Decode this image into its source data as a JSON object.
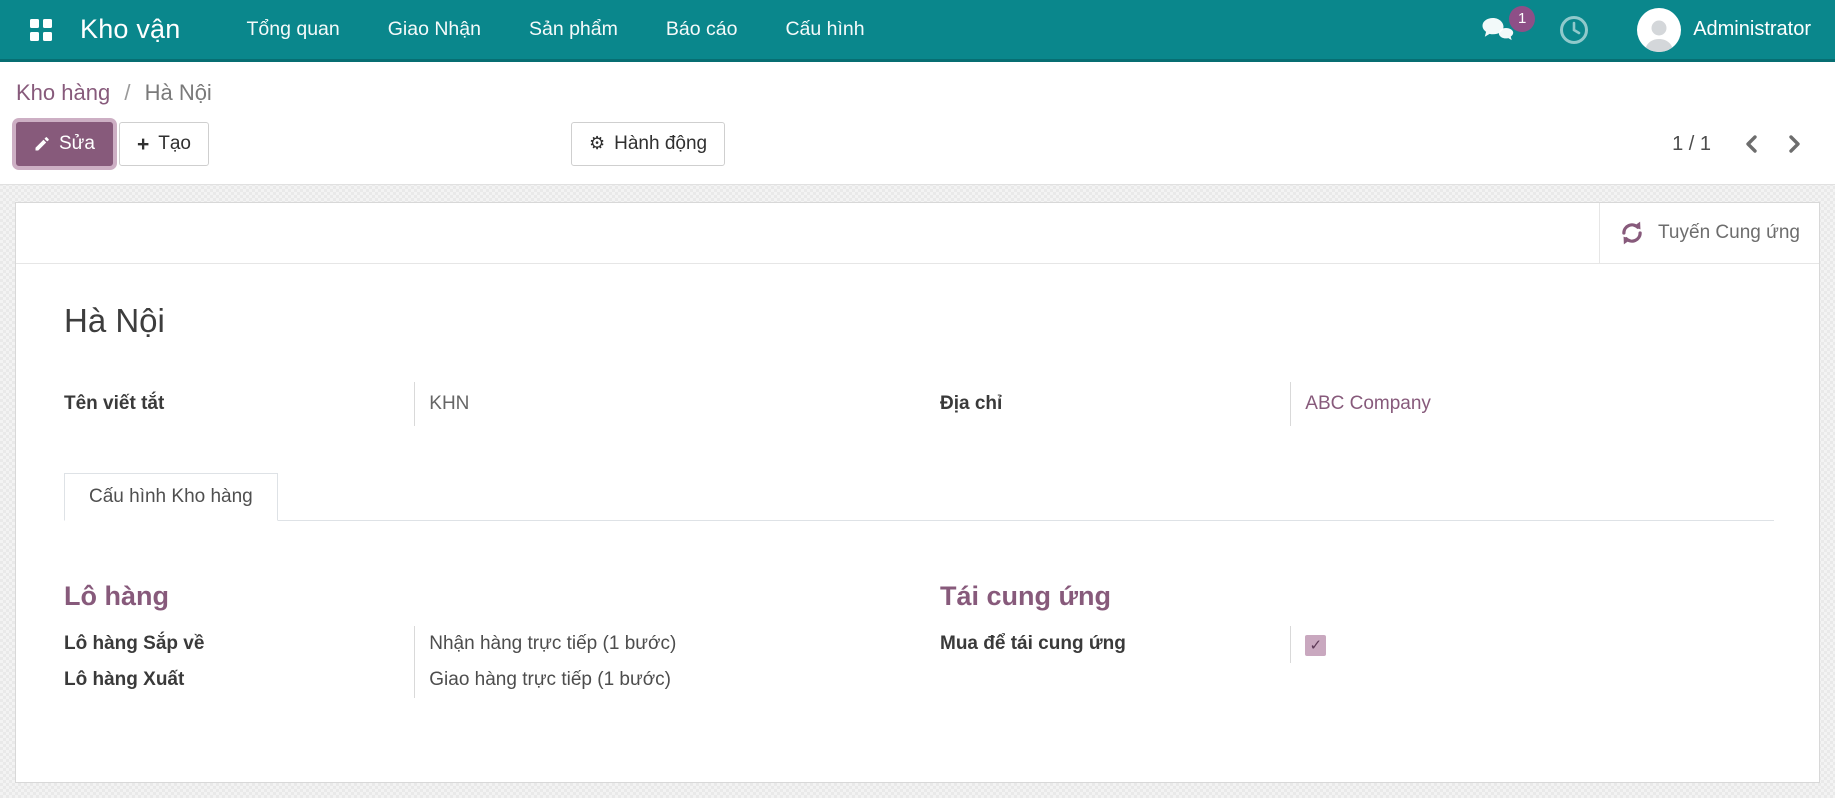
{
  "colors": {
    "navbar": "#0a878c",
    "accent": "#875A7B"
  },
  "navbar": {
    "brand": "Kho vận",
    "menus": [
      {
        "label": "Tổng quan"
      },
      {
        "label": "Giao Nhận"
      },
      {
        "label": "Sản phẩm"
      },
      {
        "label": "Báo cáo"
      },
      {
        "label": "Cấu hình"
      }
    ],
    "message_badge": "1",
    "user_name": "Administrator"
  },
  "breadcrumb": {
    "parent": "Kho hàng",
    "separator": "/",
    "current": "Hà Nội"
  },
  "control_panel": {
    "edit_label": "Sửa",
    "create_label": "Tạo",
    "create_plus": "+",
    "action_label": "Hành động",
    "action_gear": "⚙",
    "pager_value": "1 / 1"
  },
  "sheet": {
    "button_box": {
      "route_button_label": "Tuyến Cung ứng"
    },
    "title": "Hà Nội",
    "fields": {
      "short_name": {
        "label": "Tên viết tắt",
        "value": "KHN"
      },
      "address": {
        "label": "Địa chỉ",
        "value": "ABC Company"
      }
    },
    "tab_label": "Cấu hình Kho hàng",
    "shipments": {
      "heading": "Lô hàng",
      "rows": [
        {
          "label": "Lô hàng Sắp về",
          "value": "Nhận hàng trực tiếp (1 bước)"
        },
        {
          "label": "Lô hàng Xuất",
          "value": "Giao hàng trực tiếp (1 bước)"
        }
      ]
    },
    "resupply": {
      "heading": "Tái cung ứng",
      "rows": [
        {
          "label": "Mua để tái cung ứng",
          "checked": true,
          "check_glyph": "✓"
        }
      ]
    }
  }
}
